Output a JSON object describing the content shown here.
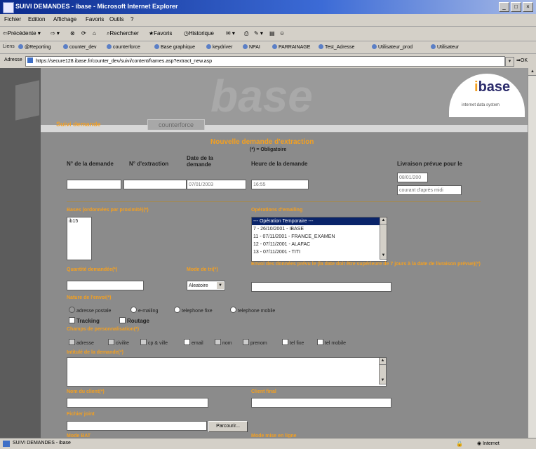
{
  "window": {
    "title": "SUIVI DEMANDES - ibase - Microsoft Internet Explorer"
  },
  "menu": [
    "Fichier",
    "Edition",
    "Affichage",
    "Favoris",
    "Outils",
    "?"
  ],
  "toolbar": {
    "back": "Précédente",
    "search": "Rechercher",
    "favorites": "Favoris",
    "history": "Historique"
  },
  "links": {
    "label": "Liens",
    "items": [
      "@Reporting",
      "counter_dev",
      "counterforce",
      "Base graphique",
      "keydriver",
      "NPAI",
      "PARRAINAGE",
      "Test_Adresse",
      "Utilisateur_prod",
      "Utilisateur"
    ]
  },
  "address": {
    "label": "Adresse",
    "url": "https://secure128.ibase.fr/counter_dev/suivi/content/frames.asp?extract_new.asp",
    "go": "OK"
  },
  "header": {
    "logo_text": "base",
    "logo_sub": "internet data system",
    "watermark": "base",
    "tab_active": "Suivi demande",
    "tab_other": "counterforce"
  },
  "form": {
    "title": "Nouvelle demande d'extraction",
    "required_note": "(*) = Obligatoire",
    "col_demande": "N° de la demande",
    "col_extraction": "N° d'extraction",
    "col_date": "Date de la demande",
    "col_heure": "Heure de la demande",
    "col_livraison": "Livraison prévue pour le",
    "date_value": "07/01/2003",
    "heure_value": "16:55",
    "livraison_date": "08/01/200",
    "livraison_when": "courant d'après midi",
    "bases_label": "Bases (ordonnées par proximité)",
    "bases_item": "ib15",
    "operations_label": "Opérations d'emailing",
    "operations": [
      "--- Opération Temporaire ---",
      "7 - 26/10/2001 - IBASE",
      "11 - 07/11/2001 - FRANCE_EXAMEN",
      "12 - 07/11/2001 - ALAFAC",
      "13 - 07/11/2001 - TITI"
    ],
    "quantite_label": "Quantité demandée",
    "mode_label": "Mode de tri",
    "mode_value": "Aleatoire",
    "envoi_label": "Envoi des données prévu le (la date doit être supérieure de 7 jours à la date de livraison prévue)",
    "nature_label": "Nature de l'envoi",
    "nature_options": [
      "adresse postale",
      "e-mailing",
      "telephone fixe",
      "telephone mobile"
    ],
    "tracking": "Tracking",
    "routage": "Routage",
    "champs_label": "Champs de personnalisation",
    "champs_options": [
      "adresse",
      "civilite",
      "cp & ville",
      "email",
      "nom",
      "prenom",
      "tel fixe",
      "tel mobile"
    ],
    "intitule_label": "Intitulé de la demande",
    "client_label": "Nom du client",
    "client_final_label": "Client final",
    "fichier_label": "Fichier joint",
    "browse": "Parcourir...",
    "bottom_left": "Mode BAT",
    "bottom_right": "Mode mise en ligne"
  },
  "status": {
    "text": "SUIVI DEMANDES - ibase",
    "zone": "Internet"
  }
}
